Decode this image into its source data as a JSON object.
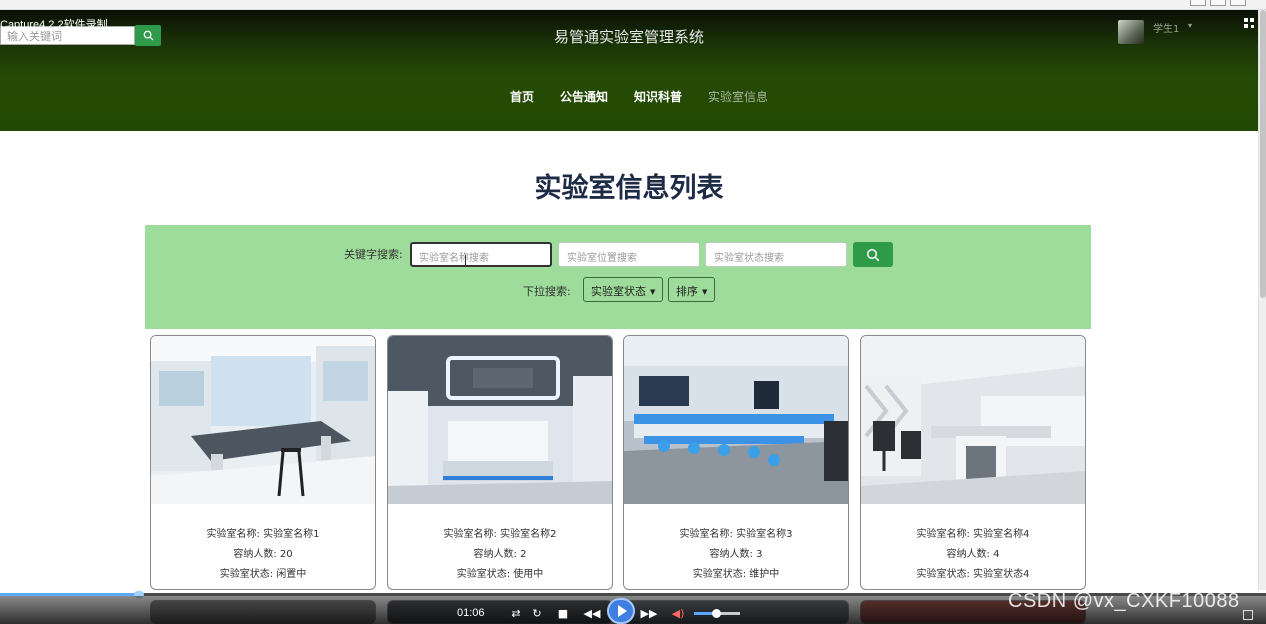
{
  "capture_tag": "Capture4.2.2软件录制",
  "top_search": {
    "placeholder": "输入关键词"
  },
  "site_title": "易管通实验室管理系统",
  "user": {
    "name": "学生1"
  },
  "nav": [
    {
      "label": "首页",
      "active": false
    },
    {
      "label": "公告通知",
      "active": false
    },
    {
      "label": "知识科普",
      "active": false
    },
    {
      "label": "实验室信息",
      "active": true
    }
  ],
  "page_title": "实验室信息列表",
  "search": {
    "keyword_label": "关键字搜索:",
    "name_placeholder": "实验室名称搜索",
    "location_placeholder": "实验室位置搜索",
    "status_placeholder": "实验室状态搜索",
    "dropdown_label": "下拉搜索:",
    "status_dropdown": "实验室状态",
    "sort_dropdown": "排序"
  },
  "cards": [
    {
      "name": "实验室名称: 实验室名称1",
      "capacity": "容纳人数: 20",
      "status": "实验室状态: 闲置中"
    },
    {
      "name": "实验室名称: 实验室名称2",
      "capacity": "容纳人数: 2",
      "status": "实验室状态: 使用中"
    },
    {
      "name": "实验室名称: 实验室名称3",
      "capacity": "容纳人数: 3",
      "status": "实验室状态: 维护中"
    },
    {
      "name": "实验室名称: 实验室名称4",
      "capacity": "容纳人数: 4",
      "status": "实验室状态: 实验室状态4"
    }
  ],
  "player": {
    "time": "01:06",
    "progress": 0.11,
    "volume": 0.5
  },
  "watermark": "CSDN @vx_CXKF10088",
  "colors": {
    "header": "#234a04",
    "accent": "#2e9a4a",
    "panel": "#9ddc9a",
    "title": "#1e2b47"
  }
}
